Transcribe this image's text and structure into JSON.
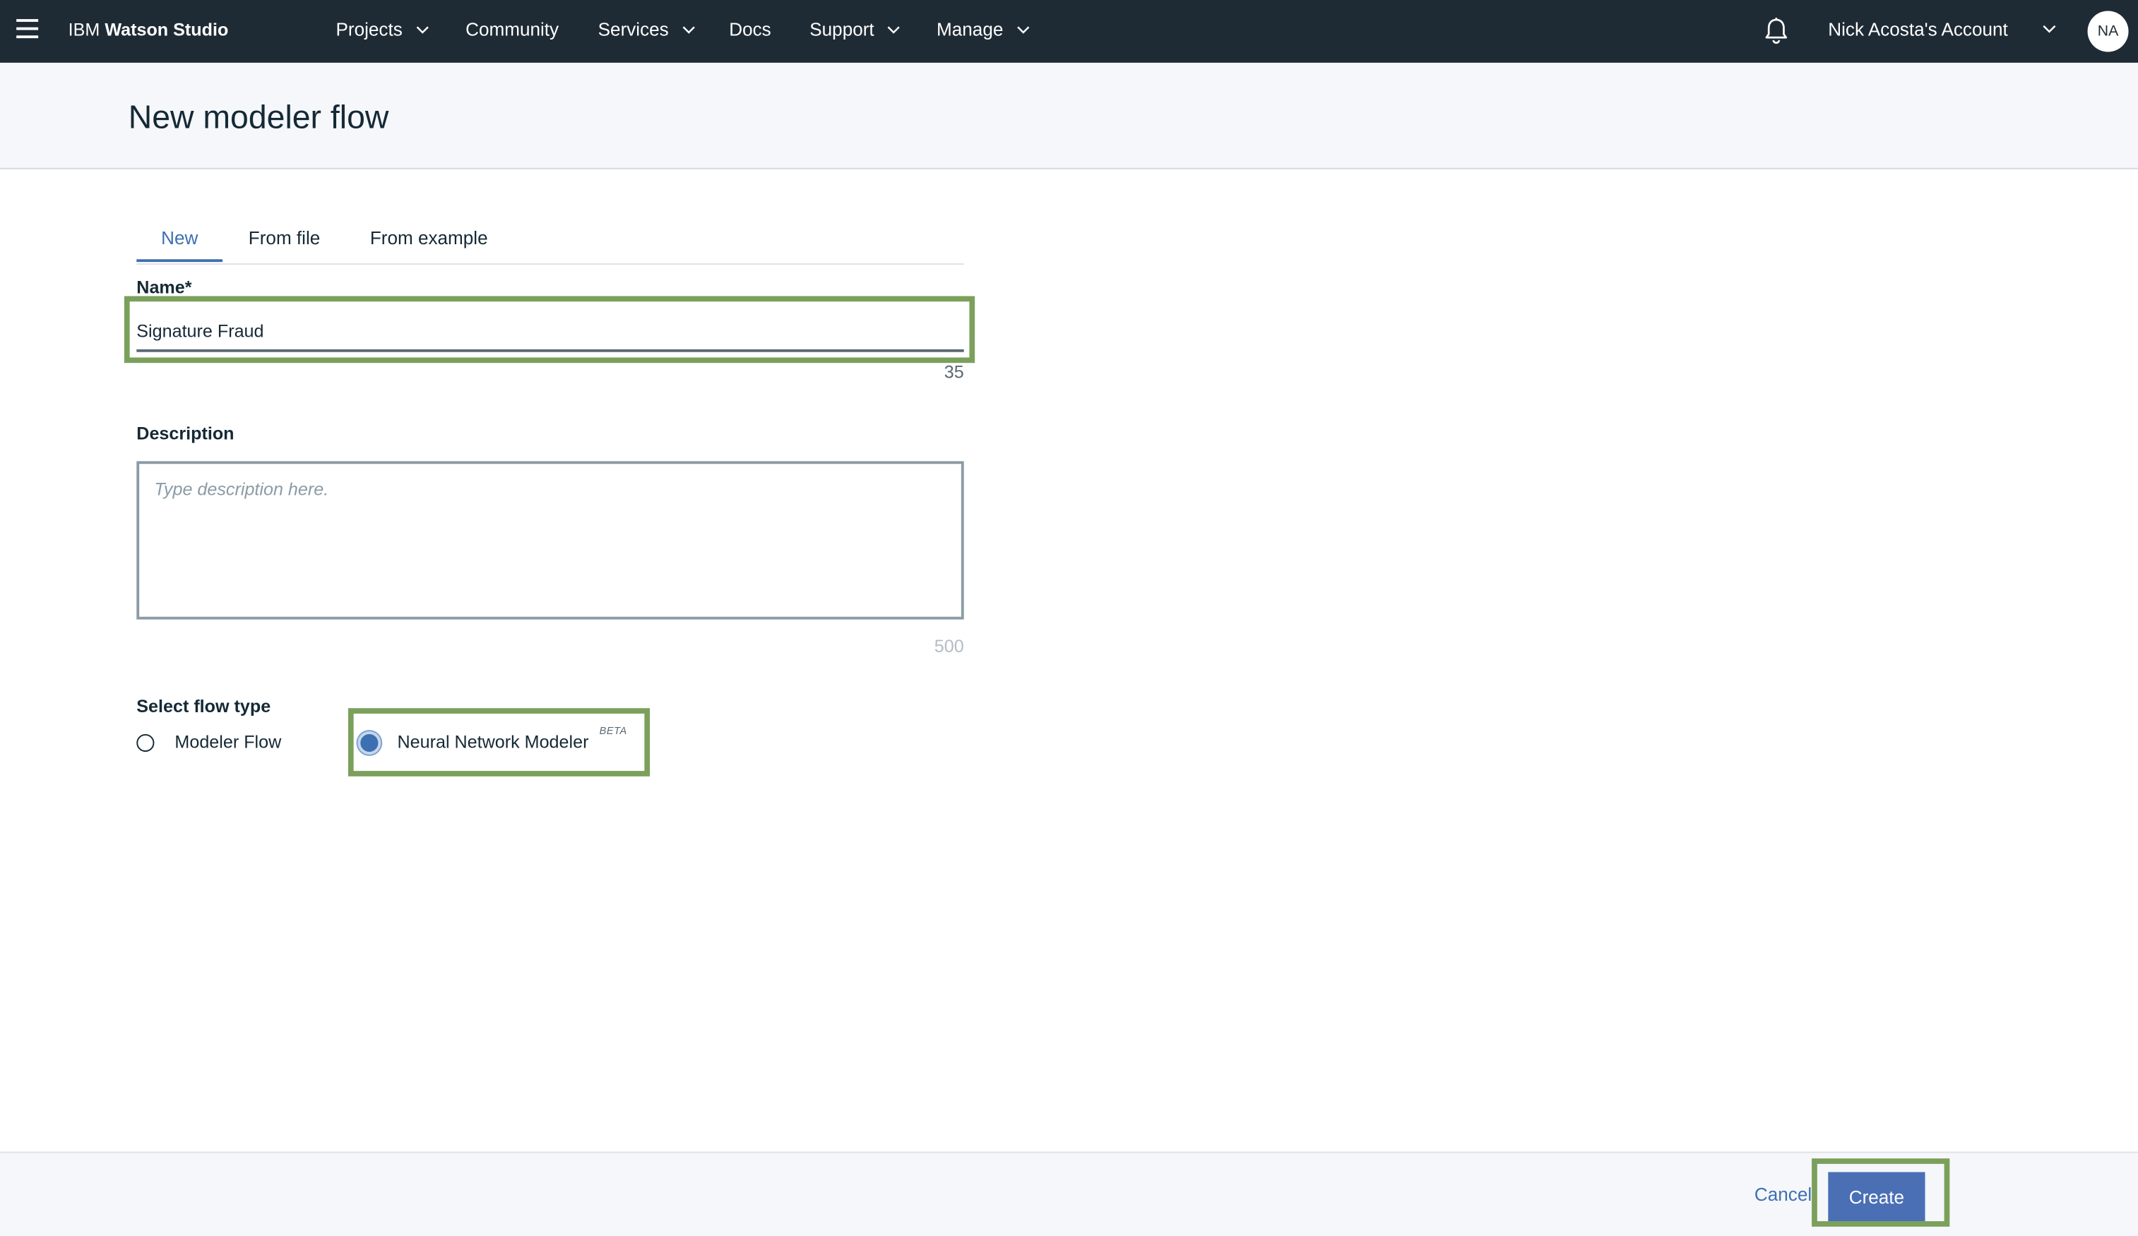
{
  "topnav": {
    "brand_prefix": "IBM",
    "brand_name": "Watson Studio",
    "items": [
      {
        "label": "Projects",
        "has_dropdown": true
      },
      {
        "label": "Community",
        "has_dropdown": false
      },
      {
        "label": "Services",
        "has_dropdown": true
      },
      {
        "label": "Docs",
        "has_dropdown": false
      },
      {
        "label": "Support",
        "has_dropdown": true
      },
      {
        "label": "Manage",
        "has_dropdown": true
      }
    ],
    "account_label": "Nick Acosta's Account",
    "avatar_initials": "NA",
    "icons": [
      "menu-icon",
      "bell-icon",
      "chevron-down-icon"
    ]
  },
  "page": {
    "title": "New modeler flow"
  },
  "tabs": [
    {
      "label": "New",
      "active": true
    },
    {
      "label": "From file",
      "active": false
    },
    {
      "label": "From example",
      "active": false
    }
  ],
  "form": {
    "name_label": "Name",
    "required_marker": "*",
    "name_value": "Signature Fraud",
    "name_char_count": "35",
    "description_label": "Description",
    "description_placeholder": "Type description here.",
    "description_char_count": "500",
    "flow_type_label": "Select flow type",
    "flow_types": [
      {
        "label": "Modeler Flow",
        "selected": false
      },
      {
        "label": "Neural Network Modeler",
        "badge": "BETA",
        "selected": true
      }
    ]
  },
  "footer": {
    "cancel_label": "Cancel",
    "create_label": "Create"
  },
  "colors": {
    "nav_bg": "#1f2b34",
    "accent": "#3d70b2",
    "primary_button": "#4a6fb5",
    "highlight": "#7ba05b"
  }
}
